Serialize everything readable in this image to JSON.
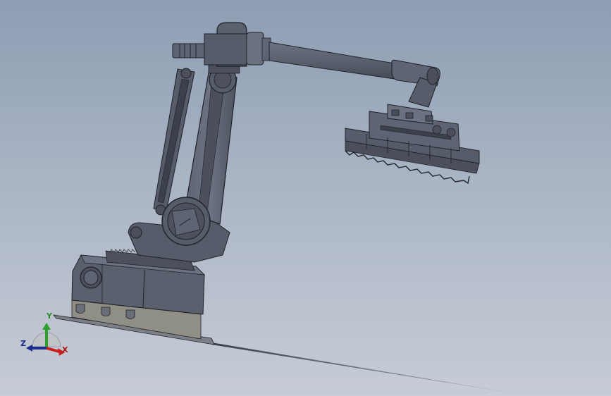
{
  "viewport": {
    "background_top": "#8e9db3",
    "background_bottom": "#c7ccd6",
    "model": "robot-arm-with-gripper"
  },
  "triad": {
    "x_label": "X",
    "y_label": "Y",
    "z_label": "Z",
    "x_color": "#c81e1e",
    "y_color": "#2e9e2e",
    "z_color": "#1c2b8c"
  },
  "colors": {
    "part": "#565c6a",
    "part_light": "#6c7282",
    "part_dark": "#3b404b",
    "edge": "#1e2128",
    "base_bottom": "#8f8f86"
  }
}
